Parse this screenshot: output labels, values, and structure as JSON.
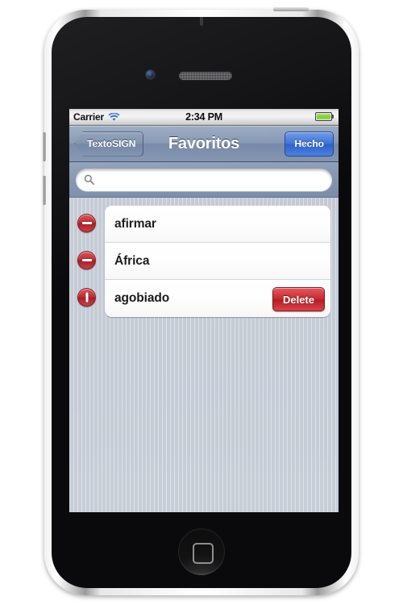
{
  "device": {
    "name": "iphone-4",
    "camera_icon": "front-camera",
    "speaker_icon": "earpiece-speaker",
    "home_button_icon": "home-button"
  },
  "status_bar": {
    "carrier": "Carrier",
    "wifi_icon": "wifi-icon",
    "time": "2:34 PM",
    "battery_icon": "battery-full-icon",
    "battery_color": "#7ec92b"
  },
  "nav_bar": {
    "back_label": "TextoSIGN",
    "title": "Favoritos",
    "done_label": "Hecho",
    "done_color": "#3c73d8",
    "bar_color": "#8496b2"
  },
  "search": {
    "value": "",
    "placeholder": "",
    "icon": "search-icon"
  },
  "list": {
    "rows": [
      {
        "label": "afirmar",
        "badge_icon": "delete-minus-icon",
        "badge_rotated": false,
        "show_delete": false,
        "delete_label": "Delete"
      },
      {
        "label": "África",
        "badge_icon": "delete-minus-icon",
        "badge_rotated": false,
        "show_delete": false,
        "delete_label": "Delete"
      },
      {
        "label": "agobiado",
        "badge_icon": "delete-minus-icon-rotated",
        "badge_rotated": true,
        "show_delete": true,
        "delete_label": "Delete"
      }
    ],
    "delete_button_color": "#cc2b33"
  }
}
